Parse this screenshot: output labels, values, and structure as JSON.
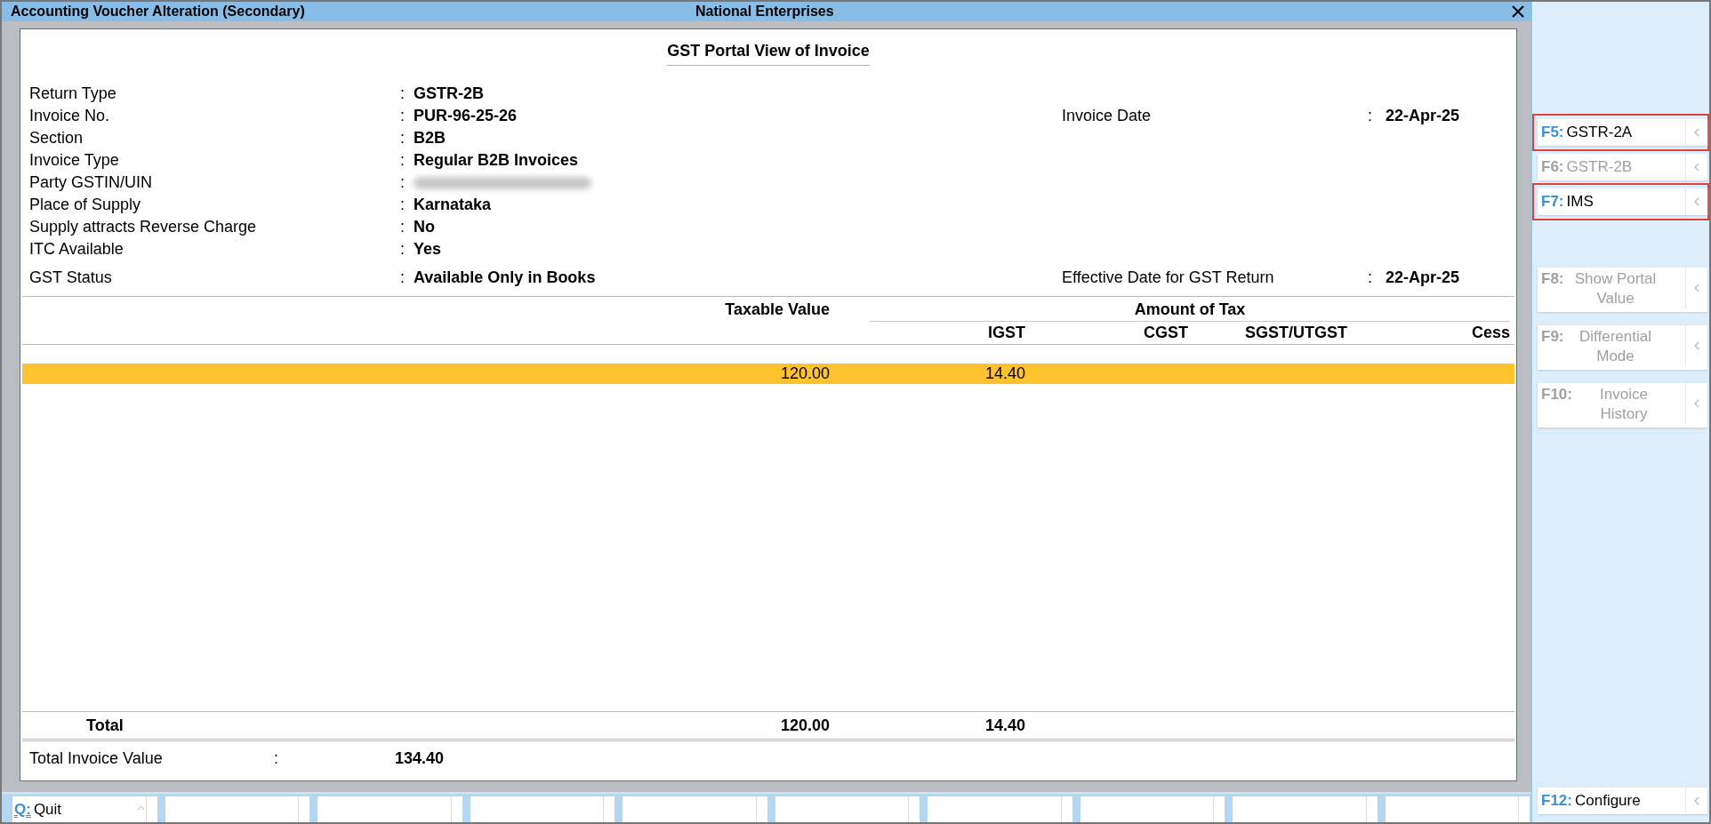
{
  "window": {
    "title": "Accounting Voucher Alteration (Secondary)",
    "company": "National Enterprises"
  },
  "dialog": {
    "title": "GST Portal View of Invoice",
    "fields": [
      {
        "label": "Return Type",
        "sep": ":",
        "value": "GSTR-2B",
        "redacted": false
      },
      {
        "label": "Invoice No.",
        "sep": ":",
        "value": "PUR-96-25-26",
        "redacted": false,
        "right": {
          "label": "Invoice Date",
          "sep": ":",
          "value": "22-Apr-25"
        }
      },
      {
        "label": "Section",
        "sep": ":",
        "value": "B2B",
        "redacted": false
      },
      {
        "label": "Invoice Type",
        "sep": ":",
        "value": "Regular B2B Invoices",
        "redacted": false
      },
      {
        "label": "Party GSTIN/UIN",
        "sep": ":",
        "redacted": true
      },
      {
        "label": "Place of Supply",
        "sep": ":",
        "value": "Karnataka",
        "redacted": false
      },
      {
        "label": "Supply attracts Reverse Charge",
        "sep": ":",
        "value": "No",
        "redacted": false
      },
      {
        "label": "ITC Available",
        "sep": ":",
        "value": "Yes",
        "redacted": false
      }
    ],
    "status": {
      "label": "GST Status",
      "sep": ":",
      "value": "Available Only in Books",
      "right": {
        "label": "Effective Date for GST Return",
        "sep": ":",
        "value": "22-Apr-25"
      }
    },
    "table": {
      "taxable_header": "Taxable Value",
      "tax_group_header": "Amount of Tax",
      "tax_columns": [
        "IGST",
        "CGST",
        "SGST/UTGST",
        "Cess"
      ],
      "rows": [
        {
          "taxable_value": "120.00",
          "igst": "14.40",
          "selected": true
        }
      ],
      "total": {
        "label": "Total",
        "taxable_value": "120.00",
        "igst": "14.40"
      }
    },
    "total_invoice_value": {
      "label": "Total Invoice Value",
      "sep": ":",
      "value": "134.40"
    }
  },
  "side_buttons": {
    "top": [
      {
        "key": "F5:",
        "label": "GSTR-2A",
        "disabled": false,
        "highlighted": true
      },
      {
        "key": "F6:",
        "label": "GSTR-2B",
        "disabled": true,
        "highlighted": false
      },
      {
        "key": "F7:",
        "label": "IMS",
        "disabled": false,
        "highlighted": true
      }
    ],
    "middle": [
      {
        "key": "F8:",
        "label": "Show Portal Value",
        "disabled": true,
        "highlighted": false
      },
      {
        "key": "F9:",
        "label": "Differential Mode",
        "disabled": true,
        "highlighted": false
      },
      {
        "key": "F10:",
        "label": "Invoice History",
        "disabled": true,
        "highlighted": false
      }
    ],
    "bottom": [
      {
        "key": "F12:",
        "label": "Configure",
        "disabled": false,
        "highlighted": false
      }
    ]
  },
  "bottom_bar": {
    "key": "Q:",
    "label": "Quit"
  }
}
